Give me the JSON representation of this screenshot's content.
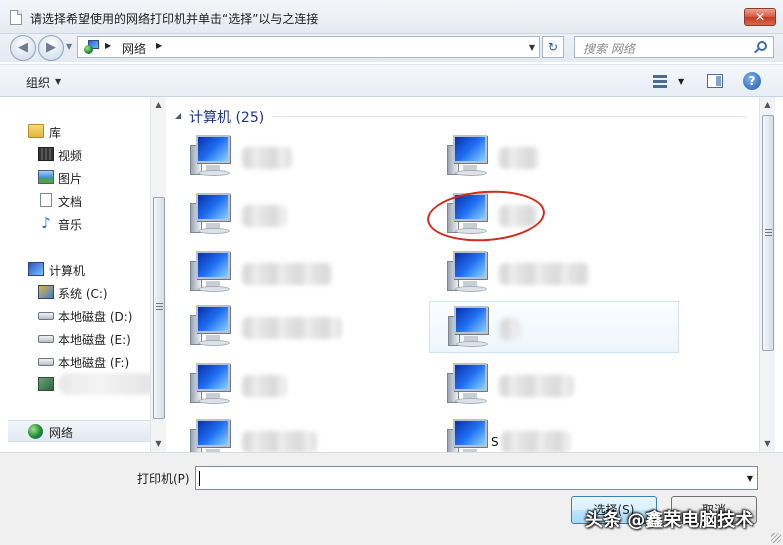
{
  "window": {
    "title": "请选择希望使用的网络打印机并单击“选择”以与之连接",
    "close_label": "✕"
  },
  "address_bar": {
    "location": "网络",
    "search_placeholder": "搜索 网络"
  },
  "toolbar": {
    "organize_label": "组织"
  },
  "nav_pane": {
    "items": [
      {
        "label": "库",
        "icon": "library-icon"
      },
      {
        "label": "视频",
        "icon": "video-icon"
      },
      {
        "label": "图片",
        "icon": "pictures-icon"
      },
      {
        "label": "文档",
        "icon": "documents-icon"
      },
      {
        "label": "音乐",
        "icon": "music-icon"
      },
      {
        "label": "计算机",
        "icon": "computer-icon"
      },
      {
        "label": "系统 (C:)",
        "icon": "system-drive-icon"
      },
      {
        "label": "本地磁盘 (D:)",
        "icon": "local-disk-icon"
      },
      {
        "label": "本地磁盘 (E:)",
        "icon": "local-disk-icon"
      },
      {
        "label": "本地磁盘 (F:)",
        "icon": "local-disk-icon"
      },
      {
        "label": "网络",
        "icon": "network-icon"
      }
    ]
  },
  "content": {
    "group_title": "计算机 (25)",
    "visible_names": [
      "S"
    ]
  },
  "bottom": {
    "printer_label": "打印机(P)",
    "printer_value": "",
    "select_label": "选择(S)",
    "cancel_label": "取消"
  },
  "watermark": "头条 @鑫荣电脑技术",
  "colors": {
    "highlight_ring": "#d32a1e",
    "group_title": "#1e3287",
    "primary_button": "#bee6fd"
  }
}
